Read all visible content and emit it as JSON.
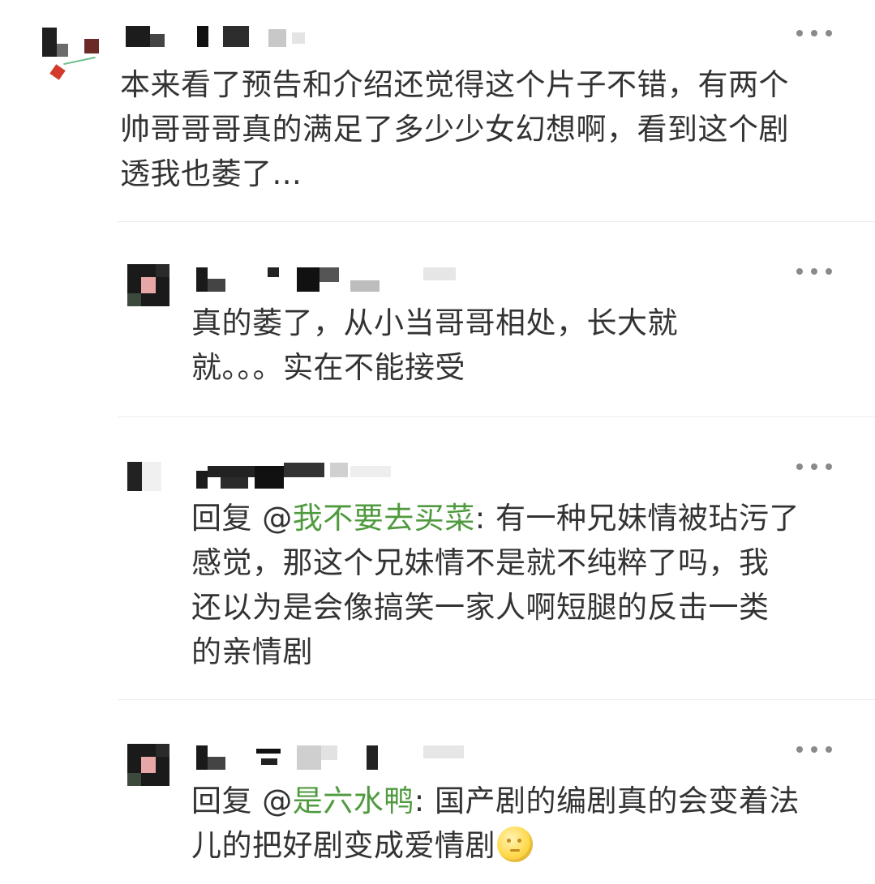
{
  "comments": [
    {
      "id": "c1",
      "text_lines": [
        "本来看了预告和介绍还觉得这个片子不错，有两个",
        "帅哥哥哥真的满足了多少少女幻想啊，看到这个剧",
        "透我也萎了..."
      ]
    },
    {
      "id": "c2",
      "text_lines": [
        "真的萎了，从小当哥哥相处，长大就",
        "就。。。实在不能接受"
      ]
    },
    {
      "id": "c3",
      "reply_prefix": "回复 @",
      "mention": "我不要去买菜",
      "reply_rest": ": 有一种兄妹情被玷污了",
      "text_lines": [
        "感觉，那这个兄妹情不是就不纯粹了吗，我",
        "还以为是会像搞笑一家人啊短腿的反击一类",
        "的亲情剧"
      ]
    },
    {
      "id": "c4",
      "reply_prefix": "回复 @",
      "mention": "是六水鸭",
      "reply_rest": ": 国产剧的编剧真的会变着法",
      "text_lines": [
        "儿的把好剧变成爱情剧"
      ],
      "emoji": "moon-face-emoji"
    }
  ],
  "colors": {
    "mention": "#4f9a3e",
    "text": "#333333",
    "more_dots": "#8a8a8a"
  },
  "icons": {
    "more": "more-options-icon",
    "avatar": "blurred-avatar"
  }
}
